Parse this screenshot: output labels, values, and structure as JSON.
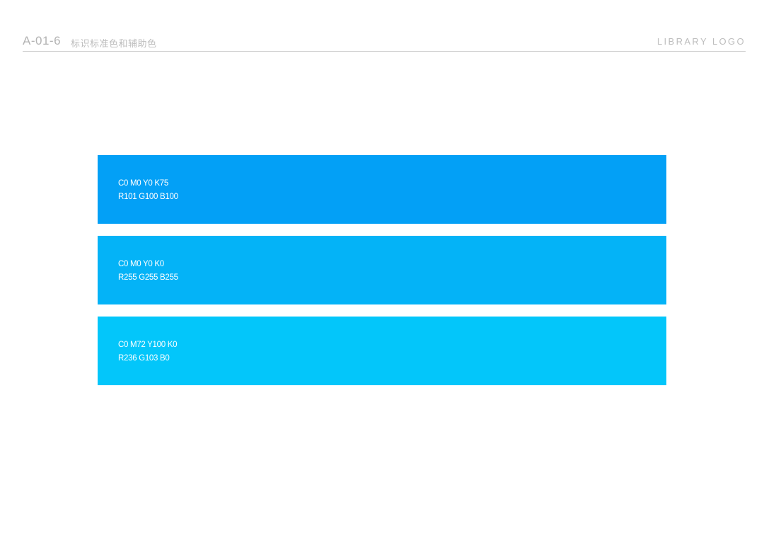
{
  "header": {
    "page_code": "A-01-6",
    "page_title": "标识标准色和辅助色",
    "brand_text": "LIBRARY LOGO"
  },
  "swatches": [
    {
      "cmyk": "C0 M0 Y0 K75",
      "rgb": "R101 G100 B100",
      "fill": "#03a0f6"
    },
    {
      "cmyk": "C0 M0 Y0 K0",
      "rgb": "R255 G255 B255",
      "fill": "#04b3f7"
    },
    {
      "cmyk": "C0 M72 Y100 K0",
      "rgb": "R236 G103 B0",
      "fill": "#03c6fa"
    }
  ]
}
